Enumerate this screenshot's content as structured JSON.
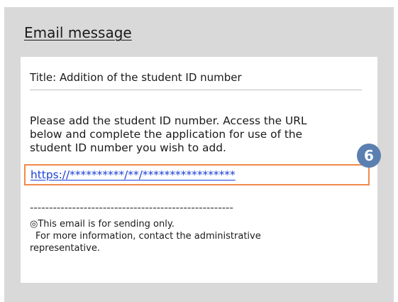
{
  "panel": {
    "heading": "Email message"
  },
  "message": {
    "subject": "Title: Addition of the student ID number",
    "body_line1": "Please add the student ID number. Access the URL",
    "body_line2": "below and complete the application for use of the",
    "body_line3": "student ID number you wish to add.",
    "url": "https://**********/**/*****************",
    "step_badge": "6",
    "divider": "-----------------------------------------------------",
    "footer_line1": "◎This email is for sending only.",
    "footer_line2": "For more information, contact the administrative",
    "footer_line3": "representative."
  },
  "colors": {
    "panel_bg": "#d9d9d9",
    "highlight_border": "#f08a4b",
    "badge_bg": "#5b7fb0",
    "link": "#1a3fd6"
  }
}
